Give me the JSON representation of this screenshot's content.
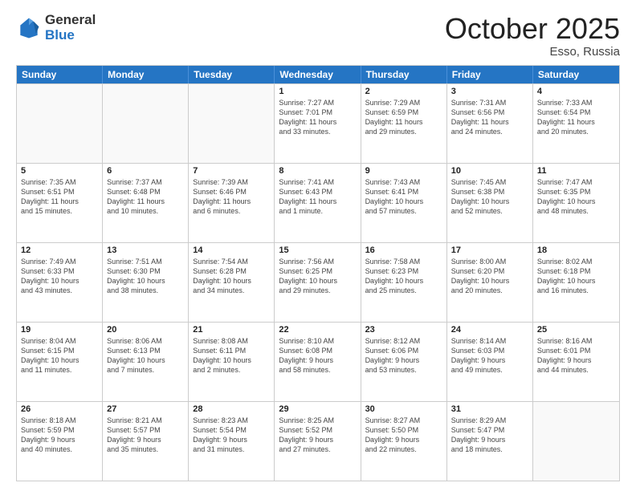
{
  "header": {
    "logo_general": "General",
    "logo_blue": "Blue",
    "title": "October 2025",
    "location": "Esso, Russia"
  },
  "days_of_week": [
    "Sunday",
    "Monday",
    "Tuesday",
    "Wednesday",
    "Thursday",
    "Friday",
    "Saturday"
  ],
  "weeks": [
    [
      {
        "day": "",
        "info": ""
      },
      {
        "day": "",
        "info": ""
      },
      {
        "day": "",
        "info": ""
      },
      {
        "day": "1",
        "info": "Sunrise: 7:27 AM\nSunset: 7:01 PM\nDaylight: 11 hours\nand 33 minutes."
      },
      {
        "day": "2",
        "info": "Sunrise: 7:29 AM\nSunset: 6:59 PM\nDaylight: 11 hours\nand 29 minutes."
      },
      {
        "day": "3",
        "info": "Sunrise: 7:31 AM\nSunset: 6:56 PM\nDaylight: 11 hours\nand 24 minutes."
      },
      {
        "day": "4",
        "info": "Sunrise: 7:33 AM\nSunset: 6:54 PM\nDaylight: 11 hours\nand 20 minutes."
      }
    ],
    [
      {
        "day": "5",
        "info": "Sunrise: 7:35 AM\nSunset: 6:51 PM\nDaylight: 11 hours\nand 15 minutes."
      },
      {
        "day": "6",
        "info": "Sunrise: 7:37 AM\nSunset: 6:48 PM\nDaylight: 11 hours\nand 10 minutes."
      },
      {
        "day": "7",
        "info": "Sunrise: 7:39 AM\nSunset: 6:46 PM\nDaylight: 11 hours\nand 6 minutes."
      },
      {
        "day": "8",
        "info": "Sunrise: 7:41 AM\nSunset: 6:43 PM\nDaylight: 11 hours\nand 1 minute."
      },
      {
        "day": "9",
        "info": "Sunrise: 7:43 AM\nSunset: 6:41 PM\nDaylight: 10 hours\nand 57 minutes."
      },
      {
        "day": "10",
        "info": "Sunrise: 7:45 AM\nSunset: 6:38 PM\nDaylight: 10 hours\nand 52 minutes."
      },
      {
        "day": "11",
        "info": "Sunrise: 7:47 AM\nSunset: 6:35 PM\nDaylight: 10 hours\nand 48 minutes."
      }
    ],
    [
      {
        "day": "12",
        "info": "Sunrise: 7:49 AM\nSunset: 6:33 PM\nDaylight: 10 hours\nand 43 minutes."
      },
      {
        "day": "13",
        "info": "Sunrise: 7:51 AM\nSunset: 6:30 PM\nDaylight: 10 hours\nand 38 minutes."
      },
      {
        "day": "14",
        "info": "Sunrise: 7:54 AM\nSunset: 6:28 PM\nDaylight: 10 hours\nand 34 minutes."
      },
      {
        "day": "15",
        "info": "Sunrise: 7:56 AM\nSunset: 6:25 PM\nDaylight: 10 hours\nand 29 minutes."
      },
      {
        "day": "16",
        "info": "Sunrise: 7:58 AM\nSunset: 6:23 PM\nDaylight: 10 hours\nand 25 minutes."
      },
      {
        "day": "17",
        "info": "Sunrise: 8:00 AM\nSunset: 6:20 PM\nDaylight: 10 hours\nand 20 minutes."
      },
      {
        "day": "18",
        "info": "Sunrise: 8:02 AM\nSunset: 6:18 PM\nDaylight: 10 hours\nand 16 minutes."
      }
    ],
    [
      {
        "day": "19",
        "info": "Sunrise: 8:04 AM\nSunset: 6:15 PM\nDaylight: 10 hours\nand 11 minutes."
      },
      {
        "day": "20",
        "info": "Sunrise: 8:06 AM\nSunset: 6:13 PM\nDaylight: 10 hours\nand 7 minutes."
      },
      {
        "day": "21",
        "info": "Sunrise: 8:08 AM\nSunset: 6:11 PM\nDaylight: 10 hours\nand 2 minutes."
      },
      {
        "day": "22",
        "info": "Sunrise: 8:10 AM\nSunset: 6:08 PM\nDaylight: 9 hours\nand 58 minutes."
      },
      {
        "day": "23",
        "info": "Sunrise: 8:12 AM\nSunset: 6:06 PM\nDaylight: 9 hours\nand 53 minutes."
      },
      {
        "day": "24",
        "info": "Sunrise: 8:14 AM\nSunset: 6:03 PM\nDaylight: 9 hours\nand 49 minutes."
      },
      {
        "day": "25",
        "info": "Sunrise: 8:16 AM\nSunset: 6:01 PM\nDaylight: 9 hours\nand 44 minutes."
      }
    ],
    [
      {
        "day": "26",
        "info": "Sunrise: 8:18 AM\nSunset: 5:59 PM\nDaylight: 9 hours\nand 40 minutes."
      },
      {
        "day": "27",
        "info": "Sunrise: 8:21 AM\nSunset: 5:57 PM\nDaylight: 9 hours\nand 35 minutes."
      },
      {
        "day": "28",
        "info": "Sunrise: 8:23 AM\nSunset: 5:54 PM\nDaylight: 9 hours\nand 31 minutes."
      },
      {
        "day": "29",
        "info": "Sunrise: 8:25 AM\nSunset: 5:52 PM\nDaylight: 9 hours\nand 27 minutes."
      },
      {
        "day": "30",
        "info": "Sunrise: 8:27 AM\nSunset: 5:50 PM\nDaylight: 9 hours\nand 22 minutes."
      },
      {
        "day": "31",
        "info": "Sunrise: 8:29 AM\nSunset: 5:47 PM\nDaylight: 9 hours\nand 18 minutes."
      },
      {
        "day": "",
        "info": ""
      }
    ]
  ]
}
